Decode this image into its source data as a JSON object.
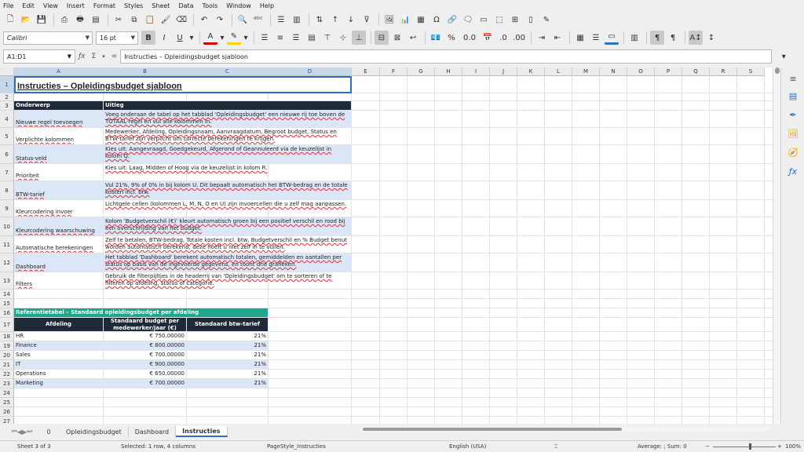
{
  "menu": [
    "File",
    "Edit",
    "View",
    "Insert",
    "Format",
    "Styles",
    "Sheet",
    "Data",
    "Tools",
    "Window",
    "Help"
  ],
  "toolbar": {
    "font_name": "Calibri",
    "font_size": "16 pt",
    "percent_label": "%",
    "decimal_label": "0.0"
  },
  "formula": {
    "namebox": "A1:D1",
    "sigma": "Σ",
    "equals": "=",
    "content": "Instructies – Opleidingsbudget sjabloon"
  },
  "columns": [
    "A",
    "B",
    "C",
    "D",
    "E",
    "F",
    "G",
    "H",
    "I",
    "J",
    "K",
    "L",
    "M",
    "N",
    "O",
    "P",
    "Q",
    "R",
    "S"
  ],
  "rows": [
    "1",
    "2",
    "3",
    "4",
    "5",
    "6",
    "7",
    "8",
    "9",
    "10",
    "11",
    "12",
    "13",
    "14",
    "15",
    "16",
    "17",
    "18",
    "19",
    "20",
    "21",
    "22",
    "23",
    "24",
    "25",
    "26",
    "27"
  ],
  "sheet": {
    "title": "Instructies – Opleidingsbudget sjabloon",
    "header_onderwerp": "Onderwerp",
    "header_uitleg": "Uitleg",
    "instructions": [
      {
        "topic": "Nieuwe regel toevoegen",
        "text": "Voeg onderaan de tabel op het tabblad 'Opleidingsbudget' een nieuwe rij toe boven de TOTAAL-regel en vul alle kolommen in."
      },
      {
        "topic": "Verplichte kolommen",
        "text": "Medewerker, Afdeling, Opleidingsnaam, Aanvraagdatum, Begroot budget, Status en BTW-tarief zijn verplicht om correcte berekeningen te krijgen."
      },
      {
        "topic": "Status-veld",
        "text": "Kies uit: Aangevraagd, Goedgekeurd, Afgerond of Geannuleerd via de keuzelijst in kolom Q."
      },
      {
        "topic": "Prioriteit",
        "text": "Kies uit: Laag, Midden of Hoog via de keuzelijst in kolom R."
      },
      {
        "topic": "BTW-tarief",
        "text": "Vul 21%, 9% of 0% in bij kolom U. Dit bepaalt automatisch het BTW-bedrag en de totale kosten incl. btw."
      },
      {
        "topic": "Kleurcodering invoer",
        "text": "Lichtgele cellen (kolommen L, M, N, O en U) zijn invoercellen die u zelf mag aanpassen."
      },
      {
        "topic": "Kleurcodering waarschuwing",
        "text": "Kolom 'Budgetverschil (€)' kleurt automatisch groen bij een positief verschil en rood bij een overschrijding van het budget."
      },
      {
        "topic": "Automatische berekeningen",
        "text": "Zelf te betalen, BTW-bedrag, Totale kosten incl. btw, Budgetverschil en % Budget benut worden automatisch berekend; deze hoeft u niet zelf in te vullen."
      },
      {
        "topic": "Dashboard",
        "text": "Het tabblad 'Dashboard' berekent automatisch totalen, gemiddelden en aantallen per status op basis van de ingevoerde gegevens, en toont drie grafieken."
      },
      {
        "topic": "Filters",
        "text": "Gebruik de filterpijltjes in de headerrij van 'Opleidingsbudget' om te sorteren of te filteren op afdeling, status of categorie."
      }
    ],
    "ref_title": "Referentietabel – Standaard opleidingsbudget per afdeling",
    "ref_headers": [
      "Afdeling",
      "Standaard budget per medewerker/jaar (€)",
      "Standaard btw-tarief"
    ],
    "ref_rows": [
      [
        "HR",
        "€ 750.00000",
        "21%"
      ],
      [
        "Finance",
        "€ 800.00000",
        "21%"
      ],
      [
        "Sales",
        "€ 700.00000",
        "21%"
      ],
      [
        "IT",
        "€ 900.00000",
        "21%"
      ],
      [
        "Operations",
        "€ 650.00000",
        "21%"
      ],
      [
        "Marketing",
        "€ 700.00000",
        "21%"
      ]
    ]
  },
  "tabs": [
    "Opleidingsbudget",
    "Dashboard",
    "Instructies"
  ],
  "tab_add": "0",
  "status": {
    "sheet": "Sheet 3 of 3",
    "selection": "Selected: 1 row, 4 columns",
    "pagestyle": "PageStyle_Instructies",
    "language": "English (USA)",
    "summary": "Average: ; Sum: 0",
    "zoom": "100%"
  }
}
